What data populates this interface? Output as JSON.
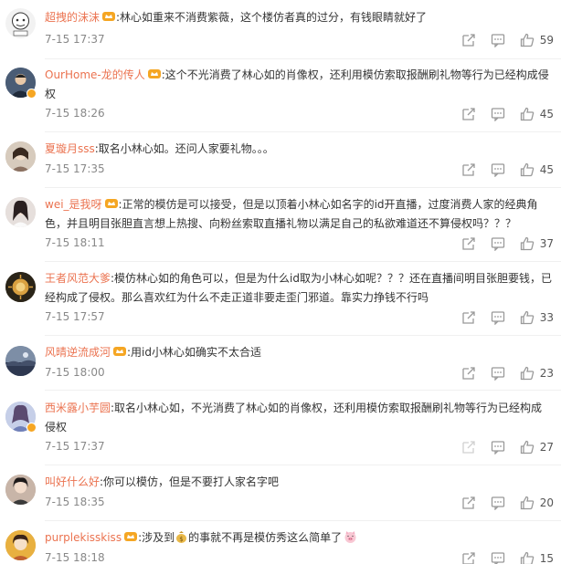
{
  "comments": [
    {
      "username": "超拽的沫沫",
      "text": ":林心如重来不消费紫薇，这个楼仿者真的过分，有钱眼睛就好了",
      "time": "7-15 17:37",
      "likes": "59",
      "avatar_bg": "#f2f2f2"
    },
    {
      "username": "OurHome-龙的传人",
      "text": ":这个不光消费了林心如的肖像权，还利用模仿索取报酬刷礼物等行为已经构成侵权",
      "time": "7-15 18:26",
      "likes": "45",
      "avatar_bg": "#5a6c85"
    },
    {
      "username": "夏璇月sss",
      "text": ":取名小林心如。还问人家要礼物。。。",
      "time": "7-15 17:35",
      "likes": "45",
      "avatar_bg": "#c9b8a6"
    },
    {
      "username": "wei_是我呀",
      "text": ":正常的模仿是可以接受，但是以顶着小林心如名字的id开直播，过度消费人家的经典角色，并且明目张胆直言想上热搜、向粉丝索取直播礼物以满足自己的私欲难道还不算侵权吗？？？",
      "time": "7-15 18:11",
      "likes": "37",
      "avatar_bg": "#d8d0cc"
    },
    {
      "username": "王者风范大爹",
      "text": ":模仿林心如的角色可以，但是为什么id取为小林心如呢？？？还在直播间明目张胆要钱，已经构成了侵权。那么喜欢红为什么不走正道非要走歪门邪道。靠实力挣钱不行吗",
      "time": "7-15 17:57",
      "likes": "33",
      "avatar_bg": "#3a3020"
    },
    {
      "username": "风晴逆流成河",
      "text": ":用id小林心如确实不太合适",
      "time": "7-15 18:00",
      "likes": "23",
      "avatar_bg": "#6e7f95"
    },
    {
      "username": "西米露小芋圆",
      "text": ":取名小林心如，不光消费了林心如的肖像权，还利用模仿索取报酬刷礼物等行为已经构成侵权",
      "time": "7-15 17:37",
      "likes": "27",
      "avatar_bg": "#aab6d8"
    },
    {
      "username": "叫好什么好",
      "text": ":你可以模仿，但是不要打人家名字吧",
      "time": "7-15 18:35",
      "likes": "20",
      "avatar_bg": "#b8a59a"
    },
    {
      "username": "purplekisskiss",
      "text_before": ":涉及到",
      "text_middle": "的事就不再是模仿秀这么简单了",
      "time": "7-15 18:18",
      "likes": "15",
      "avatar_bg": "#e0a030"
    }
  ],
  "icons": {
    "share": "share-icon",
    "comment": "comment-icon",
    "like": "thumbs-up-icon",
    "member_badge": "member-crown-icon",
    "verified": "verified-badge-icon"
  },
  "colors": {
    "username": "#eb7350",
    "text": "#333333",
    "meta": "#888888",
    "icon": "#999999",
    "member_badge": "#f5a623"
  }
}
